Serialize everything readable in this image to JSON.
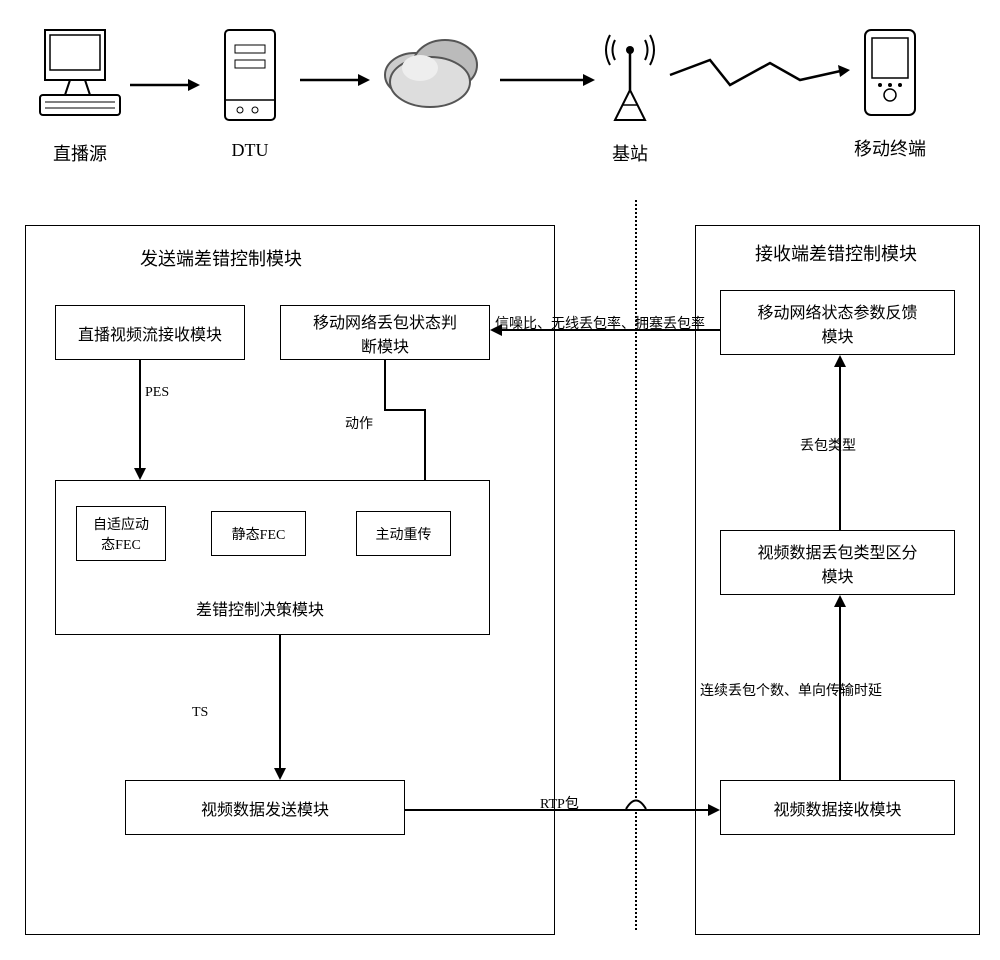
{
  "icons": {
    "source": "直播源",
    "dtu": "DTU",
    "base": "基站",
    "mobile": "移动终端"
  },
  "sender": {
    "title": "发送端差错控制模块",
    "video_recv": "直播视频流接收模块",
    "net_judge": "移动网络丢包状态判\n断模块",
    "pes": "PES",
    "action": "动作",
    "decision": {
      "adaptive_fec": "自适应动\n态FEC",
      "static_fec": "静态FEC",
      "retransmit": "主动重传",
      "title": "差错控制决策模块"
    },
    "ts": "TS",
    "video_send": "视频数据发送模块"
  },
  "middle": {
    "feedback_params": "信噪比、无线丢包率、拥塞丢包率",
    "rtp": "RTP包"
  },
  "receiver": {
    "title": "接收端差错控制模块",
    "param_feedback": "移动网络状态参数反馈\n模块",
    "loss_type": "丢包类型",
    "type_classify": "视频数据丢包类型区分\n模块",
    "loss_params": "连续丢包个数、单向传输时延",
    "video_recv": "视频数据接收模块"
  }
}
